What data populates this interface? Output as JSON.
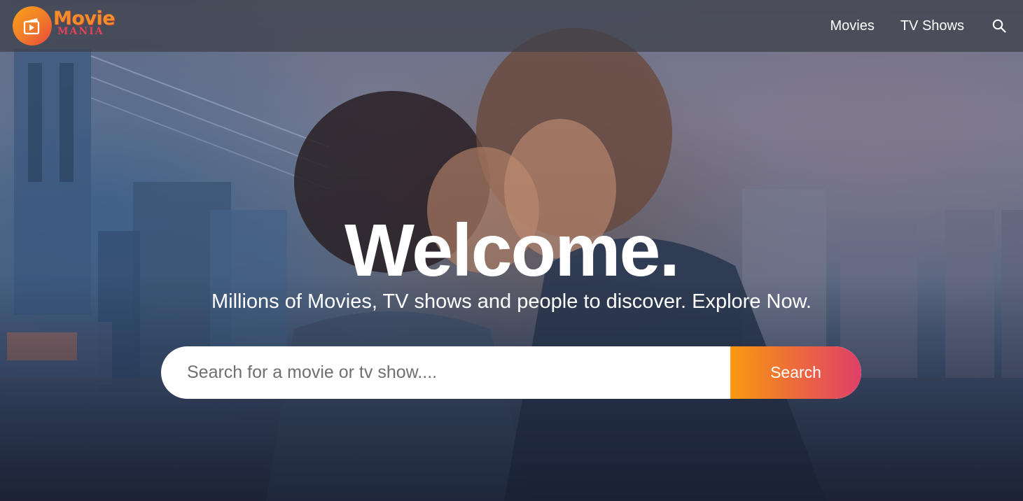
{
  "brand": {
    "logo_word_1": "Movie",
    "logo_word_2": "MANIA",
    "logo_icon": "clapperboard-play-icon",
    "colors": {
      "primary_orange": "#f89a10",
      "primary_pink": "#df3f6a"
    }
  },
  "nav": {
    "items": [
      {
        "label": "Movies"
      },
      {
        "label": "TV Shows"
      }
    ],
    "search_icon": "search-icon"
  },
  "hero": {
    "title": "Welcome.",
    "subtitle": "Millions of Movies, TV shows and people to discover. Explore Now.",
    "search": {
      "placeholder": "Search for a movie or tv show....",
      "value": "",
      "button_label": "Search"
    }
  }
}
